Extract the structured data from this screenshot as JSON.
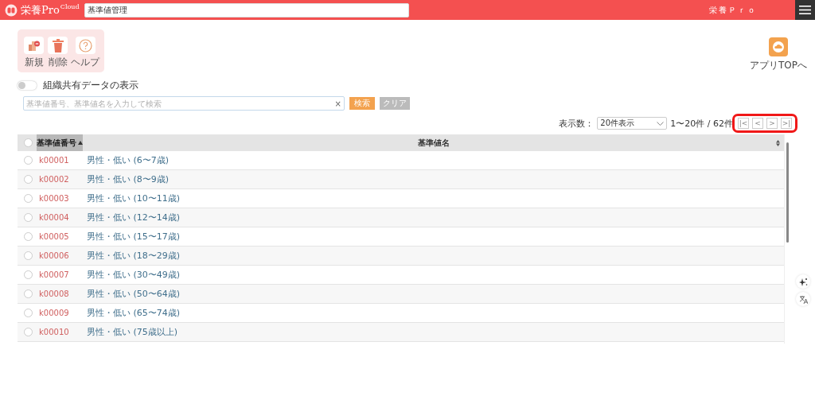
{
  "header": {
    "logo_text": "栄養Pro",
    "logo_sup": "Cloud",
    "title_field": {
      "value": "基準値管理"
    },
    "app_name": "栄養Ｐｒｏ"
  },
  "toolbar": [
    {
      "kind": "new",
      "label": "新規"
    },
    {
      "kind": "delete",
      "label": "削除"
    },
    {
      "kind": "help",
      "label": "ヘルプ"
    }
  ],
  "app_top": {
    "label": "アプリTOPへ"
  },
  "shared_toggle": {
    "label": "組織共有データの表示",
    "on": false
  },
  "search": {
    "placeholder": "基準値番号、基準値名を入力して検索",
    "clear_icon": "×",
    "search_button": "検索",
    "clear_button": {
      "label": "クリア",
      "disabled": true
    }
  },
  "pager": {
    "per_page_label": "表示数：",
    "per_page": "20件表示",
    "range": "1〜20件 / 62件",
    "buttons": [
      "|<",
      "<",
      ">",
      ">|"
    ]
  },
  "table": {
    "all_selected": false,
    "columns": [
      {
        "label": "基準値番号",
        "sorted": true
      },
      {
        "label": "基準値名",
        "sorted": false
      }
    ],
    "rows": [
      {
        "code": "k00001",
        "name": "男性・低い (6〜7歳)",
        "selected": false
      },
      {
        "code": "k00002",
        "name": "男性・低い (8〜9歳)",
        "selected": false
      },
      {
        "code": "k00003",
        "name": "男性・低い (10〜11歳)",
        "selected": false
      },
      {
        "code": "k00004",
        "name": "男性・低い (12〜14歳)",
        "selected": false
      },
      {
        "code": "k00005",
        "name": "男性・低い (15〜17歳)",
        "selected": false
      },
      {
        "code": "k00006",
        "name": "男性・低い (18〜29歳)",
        "selected": false
      },
      {
        "code": "k00007",
        "name": "男性・低い (30〜49歳)",
        "selected": false
      },
      {
        "code": "k00008",
        "name": "男性・低い (50〜64歳)",
        "selected": false
      },
      {
        "code": "k00009",
        "name": "男性・低い (65〜74歳)",
        "selected": false
      },
      {
        "code": "k00010",
        "name": "男性・低い (75歳以上)",
        "selected": false
      }
    ]
  }
}
